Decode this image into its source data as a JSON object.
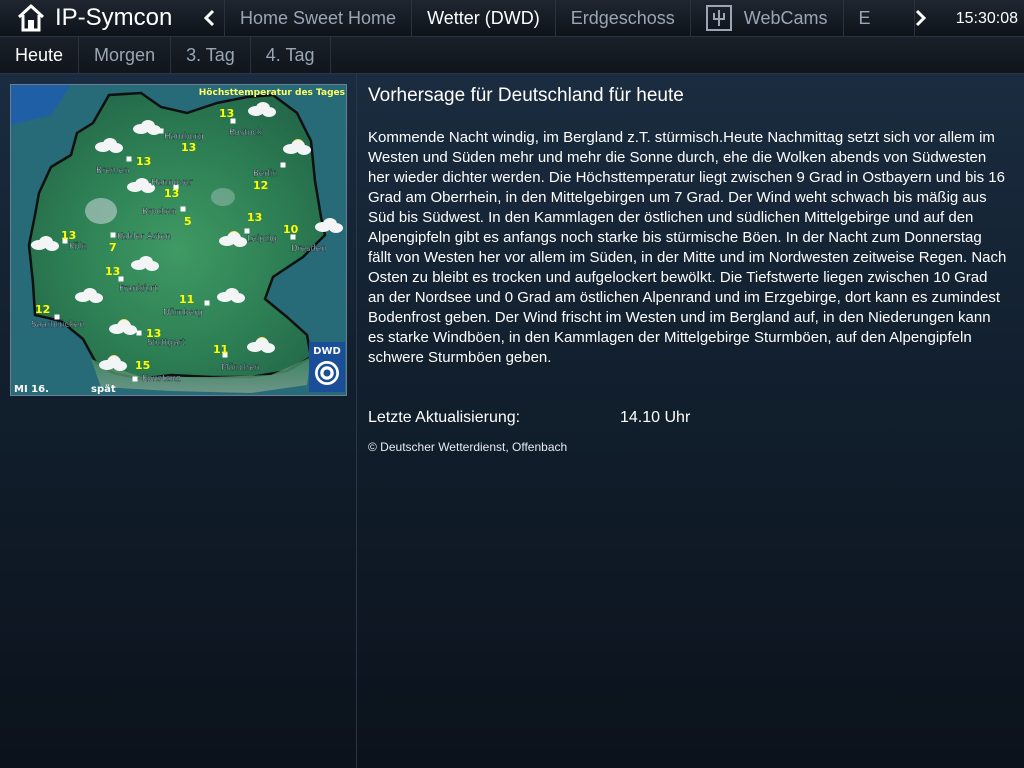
{
  "app": {
    "name": "IP-Symcon"
  },
  "nav": {
    "tabs": [
      {
        "label": "Home Sweet Home"
      },
      {
        "label": "Wetter (DWD)"
      },
      {
        "label": "Erdgeschoss"
      },
      {
        "label": "WebCams"
      },
      {
        "label": "E"
      }
    ]
  },
  "clock": "15:30:08",
  "subtabs": [
    {
      "label": "Heute"
    },
    {
      "label": "Morgen"
    },
    {
      "label": "3. Tag"
    },
    {
      "label": "4. Tag"
    }
  ],
  "map": {
    "title": "Höchsttemperatur des Tages",
    "date": "MI 16.",
    "period": "spät",
    "logo": "DWD",
    "cities": [
      {
        "name": "Hamburg",
        "temp": "13"
      },
      {
        "name": "Rostock",
        "temp": "13"
      },
      {
        "name": "Bremen",
        "temp": "13"
      },
      {
        "name": "Hannover",
        "temp": "13"
      },
      {
        "name": "Berlin",
        "temp": "12"
      },
      {
        "name": "Brocken",
        "temp": "5"
      },
      {
        "name": "Kahler Asten",
        "temp": "7"
      },
      {
        "name": "Köln",
        "temp": "13"
      },
      {
        "name": "Leipzig",
        "temp": "13"
      },
      {
        "name": "Dresden",
        "temp": "10"
      },
      {
        "name": "Frankfurt",
        "temp": "13"
      },
      {
        "name": "Nürnberg",
        "temp": "11"
      },
      {
        "name": "Saarbrücken",
        "temp": "12"
      },
      {
        "name": "Stuttgart",
        "temp": "13"
      },
      {
        "name": "München",
        "temp": "11"
      },
      {
        "name": "Konstanz",
        "temp": "15"
      }
    ]
  },
  "forecast": {
    "title": "Vorhersage für Deutschland für heute",
    "text": "Kommende Nacht windig, im Bergland z.T. stürmisch.Heute Nachmittag setzt sich vor allem im Westen und Süden mehr und mehr die Sonne durch, ehe die Wolken abends von Südwesten her wieder dichter werden. Die Höchsttemperatur liegt zwischen 9 Grad in Ostbayern und bis 16 Grad am Oberrhein, in den Mittelgebirgen um 7 Grad. Der Wind weht schwach bis mäßig aus Süd bis Südwest. In den Kammlagen der östlichen und südlichen Mittelgebirge und auf den Alpengipfeln gibt es anfangs noch starke bis stürmische Böen. In der Nacht zum Donnerstag fällt von Westen her vor allem im Süden, in der Mitte und im Nordwesten zeitweise Regen. Nach Osten zu bleibt es trocken und aufgelockert bewölkt. Die Tiefstwerte liegen zwischen 10 Grad an der Nordsee und 0 Grad am östlichen Alpenrand und im Erzgebirge, dort kann es zumindest Bodenfrost geben. Der Wind frischt im Westen und im Bergland auf, in den Niederungen kann es starke Windböen, in den Kammlagen der Mittelgebirge Sturmböen, auf den Alpengipfeln schwere Sturmböen geben.",
    "update_label": "Letzte Aktualisierung:",
    "update_value": "14.10 Uhr",
    "copyright": "© Deutscher Wetterdienst, Offenbach"
  },
  "colors": {
    "accent": "#ffffff",
    "inactive_tab": "#9aa6b4",
    "map_sea": "#1e5fa6",
    "map_land": "#2e8a5a",
    "temperature": "#ffff00"
  }
}
